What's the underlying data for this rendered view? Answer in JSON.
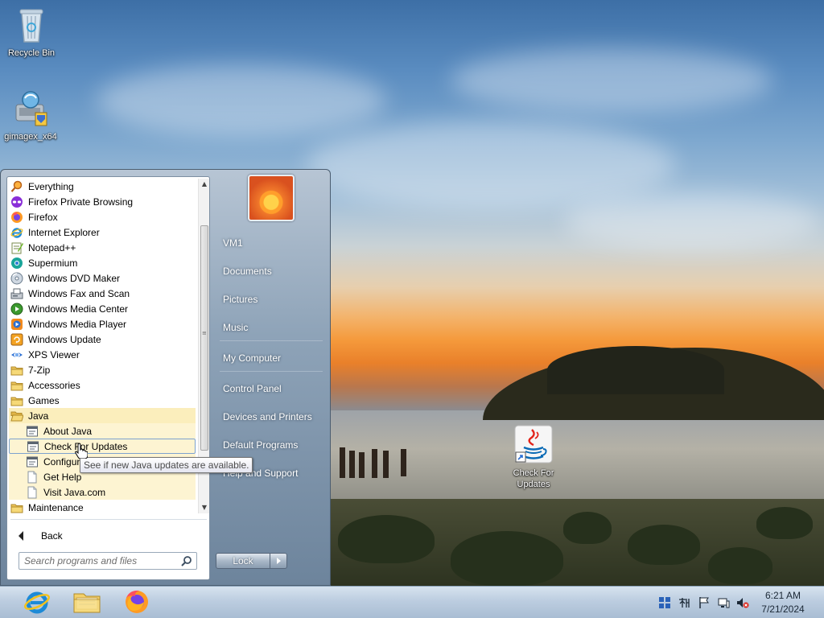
{
  "desktop": {
    "icons": [
      {
        "label": "Recycle Bin",
        "icon": "recycle-bin-icon"
      },
      {
        "label": "gimagex_x64",
        "icon": "gimagex-icon"
      },
      {
        "label": "Check For Updates",
        "icon": "java-icon"
      }
    ]
  },
  "start_menu": {
    "programs": [
      {
        "label": "Everything",
        "icon": "everything-icon"
      },
      {
        "label": "Firefox Private Browsing",
        "icon": "firefox-private-icon"
      },
      {
        "label": "Firefox",
        "icon": "firefox-icon"
      },
      {
        "label": "Internet Explorer",
        "icon": "internet-explorer-icon"
      },
      {
        "label": "Notepad++",
        "icon": "notepad-plus-plus-icon"
      },
      {
        "label": "Supermium",
        "icon": "supermium-icon"
      },
      {
        "label": "Windows DVD Maker",
        "icon": "dvd-maker-icon"
      },
      {
        "label": "Windows Fax and Scan",
        "icon": "fax-scan-icon"
      },
      {
        "label": "Windows Media Center",
        "icon": "media-center-icon"
      },
      {
        "label": "Windows Media Player",
        "icon": "media-player-icon"
      },
      {
        "label": "Windows Update",
        "icon": "windows-update-icon"
      },
      {
        "label": "XPS Viewer",
        "icon": "xps-viewer-icon"
      },
      {
        "label": "7-Zip",
        "icon": "folder-icon"
      },
      {
        "label": "Accessories",
        "icon": "folder-icon"
      },
      {
        "label": "Games",
        "icon": "folder-icon"
      },
      {
        "label": "Java",
        "icon": "folder-open-icon"
      },
      {
        "label": "About Java",
        "icon": "java-app-icon"
      },
      {
        "label": "Check For Updates",
        "icon": "java-app-icon"
      },
      {
        "label": "Configure Java",
        "icon": "java-app-icon"
      },
      {
        "label": "Get Help",
        "icon": "document-icon"
      },
      {
        "label": "Visit Java.com",
        "icon": "document-icon"
      },
      {
        "label": "Maintenance",
        "icon": "folder-icon"
      }
    ],
    "back_label": "Back",
    "search_placeholder": "Search programs and files",
    "tooltip": "See if new Java updates are available.",
    "right_items": [
      "VM1",
      "Documents",
      "Pictures",
      "Music",
      "My Computer",
      "Control Panel",
      "Devices and Printers",
      "Default Programs",
      "Help and Support"
    ],
    "lock_label": "Lock"
  },
  "taskbar": {
    "pinned": [
      {
        "name": "Internet Explorer",
        "icon": "internet-explorer-icon"
      },
      {
        "name": "Windows Explorer",
        "icon": "file-explorer-icon"
      },
      {
        "name": "Firefox",
        "icon": "firefox-icon"
      }
    ],
    "tray_icons": [
      "network-grid-icon",
      "language-bar-icon",
      "action-center-flag-icon",
      "display-icon",
      "volume-muted-icon"
    ],
    "clock": {
      "time": "6:21 AM",
      "date": "7/21/2024"
    }
  },
  "colors": {
    "selection_highlight": "#c7dcf3",
    "java_group_highlight": "#fbeebc",
    "taskbar": "#bccde0"
  }
}
